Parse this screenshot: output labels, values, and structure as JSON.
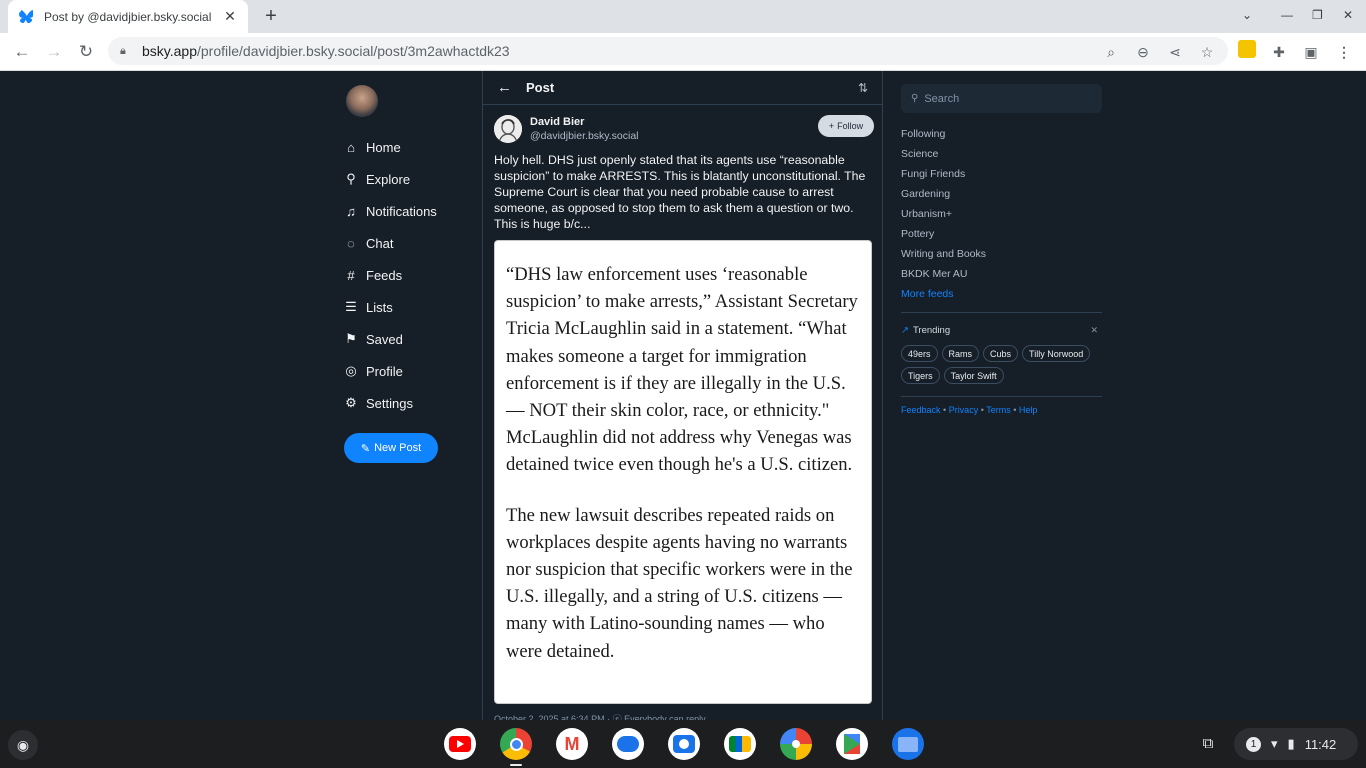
{
  "browser": {
    "tab_title": "Post by @davidjbier.bsky.social",
    "url_host": "bsky.app",
    "url_path": "/profile/davidjbier.bsky.social/post/3m2awhactdk23",
    "icons": [
      "back-icon",
      "forward-icon",
      "reload-icon",
      "lock-icon",
      "search-icon",
      "zoom-out-icon",
      "share-icon",
      "star-icon",
      "extensions-icon",
      "sidepanel-icon",
      "menu-icon"
    ]
  },
  "nav": {
    "items": [
      {
        "label": "Home",
        "icon": "home-icon"
      },
      {
        "label": "Explore",
        "icon": "search-icon"
      },
      {
        "label": "Notifications",
        "icon": "bell-icon"
      },
      {
        "label": "Chat",
        "icon": "chat-icon"
      },
      {
        "label": "Feeds",
        "icon": "hash-icon"
      },
      {
        "label": "Lists",
        "icon": "list-icon"
      },
      {
        "label": "Saved",
        "icon": "bookmark-icon"
      },
      {
        "label": "Profile",
        "icon": "user-icon"
      },
      {
        "label": "Settings",
        "icon": "gear-icon"
      }
    ],
    "new_post": "New Post"
  },
  "post": {
    "header_title": "Post",
    "author_name": "David Bier",
    "author_handle": "@davidjbier.bsky.social",
    "follow_label": "Follow",
    "text": "Holy hell. DHS just openly stated that its agents use “reasonable suspicion” to make ARRESTS. This is blatantly unconstitutional. The Supreme Court is clear that you need probable cause to arrest someone, as opposed to stop them to ask them a question or two. This is huge b/c...",
    "image_paragraph_1": "“DHS law enforcement uses ‘reasonable suspicion’ to make arrests,” Assistant Secretary Tricia McLaughlin said in a statement. “What makes someone a target for immigration enforcement is if they are illegally in the U.S. — NOT their skin color, race, or ethnicity.\" McLaughlin did not address why Venegas was detained twice even though he's a U.S. citizen.",
    "image_paragraph_2": "The new lawsuit describes repeated raids on workplaces despite agents having no warrants nor suspicion that specific workers were in the U.S. illegally, and a string of U.S. citizens — many with Latino-sounding names — who were detained.",
    "meta": "October 2, 2025 at 6:34 PM · ⓔ Everybody can reply"
  },
  "sidebar": {
    "search_placeholder": "Search",
    "feeds": [
      "Following",
      "Science",
      "Fungi Friends",
      "Gardening",
      "Urbanism+",
      "Pottery",
      "Writing and Books",
      "BKDK Mer AU"
    ],
    "more_feeds": "More feeds",
    "trending_title": "Trending",
    "trending": [
      "49ers",
      "Rams",
      "Cubs",
      "Tilly Norwood",
      "Tigers",
      "Taylor Swift"
    ],
    "footer": [
      "Feedback",
      "Privacy",
      "Terms",
      "Help"
    ]
  },
  "shelf": {
    "apps": [
      "youtube-icon",
      "chrome-icon",
      "gmail-icon",
      "messages-icon",
      "camera-icon",
      "meet-icon",
      "photos-icon",
      "play-store-icon",
      "files-icon"
    ],
    "notification_count": "1",
    "time": "11:42"
  },
  "colors": {
    "accent": "#1083fe",
    "background": "#161e27",
    "border": "#2e4052"
  }
}
